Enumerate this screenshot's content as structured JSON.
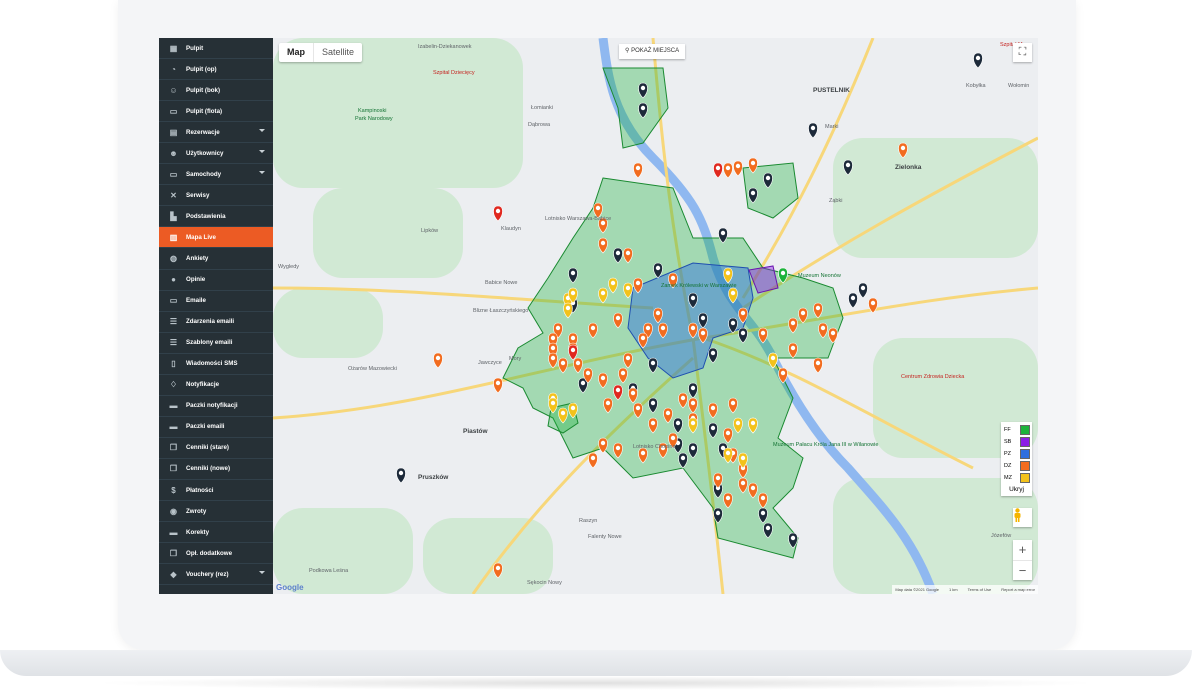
{
  "sidebar": {
    "items": [
      {
        "label": "Pulpit",
        "icon": "grid-icon",
        "caret": false,
        "active": false
      },
      {
        "label": "Pulpit (op)",
        "icon": "gauge-icon",
        "caret": false,
        "active": false
      },
      {
        "label": "Pulpit (bok)",
        "icon": "users-icon",
        "caret": false,
        "active": false
      },
      {
        "label": "Pulpit (flota)",
        "icon": "car-icon",
        "caret": false,
        "active": false
      },
      {
        "label": "Rezerwacje",
        "icon": "calendar-icon",
        "caret": true,
        "active": false
      },
      {
        "label": "Użytkownicy",
        "icon": "user-group-icon",
        "caret": true,
        "active": false
      },
      {
        "label": "Samochody",
        "icon": "car-icon",
        "caret": true,
        "active": false
      },
      {
        "label": "Serwisy",
        "icon": "tools-icon",
        "caret": false,
        "active": false
      },
      {
        "label": "Podstawienia",
        "icon": "building-icon",
        "caret": false,
        "active": false
      },
      {
        "label": "Mapa Live",
        "icon": "map-icon",
        "caret": false,
        "active": true
      },
      {
        "label": "Ankiety",
        "icon": "globe-icon",
        "caret": false,
        "active": false
      },
      {
        "label": "Opinie",
        "icon": "info-icon",
        "caret": false,
        "active": false
      },
      {
        "label": "Emaile",
        "icon": "inbox-icon",
        "caret": false,
        "active": false
      },
      {
        "label": "Zdarzenia emaili",
        "icon": "list-icon",
        "caret": false,
        "active": false
      },
      {
        "label": "Szablony emaili",
        "icon": "list-icon",
        "caret": false,
        "active": false
      },
      {
        "label": "Wiadomości SMS",
        "icon": "phone-icon",
        "caret": false,
        "active": false
      },
      {
        "label": "Notyfikacje",
        "icon": "bell-icon",
        "caret": false,
        "active": false
      },
      {
        "label": "Paczki notyfikacji",
        "icon": "stack-icon",
        "caret": false,
        "active": false
      },
      {
        "label": "Paczki emaili",
        "icon": "stack-icon",
        "caret": false,
        "active": false
      },
      {
        "label": "Cenniki (stare)",
        "icon": "copy-icon",
        "caret": false,
        "active": false
      },
      {
        "label": "Cenniki (nowe)",
        "icon": "copy-icon",
        "caret": false,
        "active": false
      },
      {
        "label": "Płatności",
        "icon": "dollar-icon",
        "caret": false,
        "active": false
      },
      {
        "label": "Zwroty",
        "icon": "refund-icon",
        "caret": false,
        "active": false
      },
      {
        "label": "Korekty",
        "icon": "card-icon",
        "caret": false,
        "active": false
      },
      {
        "label": "Opł. dodatkowe",
        "icon": "copy-icon",
        "caret": false,
        "active": false
      },
      {
        "label": "Vouchery (rez)",
        "icon": "tag-icon",
        "caret": true,
        "active": false
      }
    ]
  },
  "map": {
    "type_map": "Map",
    "type_satellite": "Satellite",
    "show_place": "POKAŻ MIEJSCA",
    "google": "Google",
    "attribution": "Map data ©2021 Google",
    "scale": "1 km",
    "terms": "Terms of Use",
    "report": "Report a map error",
    "legend": [
      {
        "code": "FF",
        "color": "#1db33b"
      },
      {
        "code": "SB",
        "color": "#8c1ee6"
      },
      {
        "code": "PZ",
        "color": "#2f6fe0"
      },
      {
        "code": "DZ",
        "color": "#f26c1f"
      },
      {
        "code": "MZ",
        "color": "#f3c21b"
      }
    ],
    "legend_hide": "Ukryj",
    "zoom_in": "+",
    "zoom_out": "−",
    "labels": {
      "izabelin": "Izabelin-Dziekanowek",
      "szpital_dz": "Szpital Dziecięcy",
      "kampinoski": "Kampinoski",
      "park": "Park Narodowy",
      "lomianki": "Łomianki",
      "dabrowa": "Dąbrowa",
      "pustelnik": "PUSTELNIK",
      "kobylka": "Kobyłka",
      "wolomin": "Wołomin",
      "marki": "Marki",
      "zielonka": "Zielonka",
      "zabki": "Ząbki",
      "lotnisko_babice": "Lotnisko Warszawa-Babice",
      "klaudyn": "Klaudyn",
      "lipkow": "Lipków",
      "zamek": "Zamek Królewski w Warszawie",
      "muzeum_neonow": "Muzeum Neonów",
      "babice": "Babice Nowe",
      "blizne": "Blizne Łaszczyńskiego",
      "wygledy": "Wygledy",
      "ozarow": "Ożarów Mazowiecki",
      "mory": "Mory",
      "jawczyce": "Jawczyce",
      "piastow": "Piastów",
      "pruszkow": "Pruszków",
      "lotnisko_chopina": "Lotnisko Chopina",
      "wilanow": "Muzeum Pałacu Króla Jana III w Wilanowie",
      "centrum_zdrowia": "Centrum Zdrowia Dziecka",
      "jozefow": "Józefów",
      "raszyn": "Raszyn",
      "sekocin": "Sękocin Nowy",
      "falenty": "Falenty Nowe",
      "podkowa": "Podkowa Leśna",
      "szpital_mag": "Szpital Mag"
    }
  }
}
